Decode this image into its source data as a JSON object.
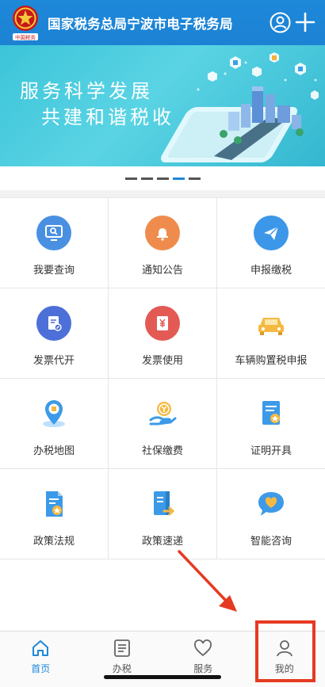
{
  "header": {
    "title": "国家税务总局宁波市电子税务局",
    "emblem_caption": "中国税务"
  },
  "banner": {
    "line1": "服务科学发展",
    "line2": "共建和谐税收",
    "page_count": 5,
    "active_page": 4
  },
  "grid": {
    "items": [
      {
        "label": "我要查询",
        "icon": "monitor-search-icon",
        "color": "#4a90e2"
      },
      {
        "label": "通知公告",
        "icon": "bell-icon",
        "color": "#ef8c4d"
      },
      {
        "label": "申报缴税",
        "icon": "paper-plane-icon",
        "color": "#3d97e8"
      },
      {
        "label": "发票代开",
        "icon": "invoice-edit-icon",
        "color": "#4d6fd8"
      },
      {
        "label": "发票使用",
        "icon": "yen-ticket-icon",
        "color": "#e35a55"
      },
      {
        "label": "车辆购置税申报",
        "icon": "car-icon",
        "color": "#f5b940"
      },
      {
        "label": "办税地图",
        "icon": "map-pin-icon",
        "color": "#3c9ae8"
      },
      {
        "label": "社保缴费",
        "icon": "hand-coin-icon",
        "color": "#f5b940"
      },
      {
        "label": "证明开具",
        "icon": "certificate-icon",
        "color": "#3c9ae8"
      },
      {
        "label": "政策法规",
        "icon": "policy-doc-icon",
        "color": "#3c9ae8"
      },
      {
        "label": "政策速递",
        "icon": "policy-express-icon",
        "color": "#3c9ae8"
      },
      {
        "label": "智能咨询",
        "icon": "chat-heart-icon",
        "color": "#3c9ae8"
      }
    ]
  },
  "tabs": {
    "items": [
      {
        "label": "首页",
        "icon": "home-icon"
      },
      {
        "label": "办税",
        "icon": "list-icon"
      },
      {
        "label": "服务",
        "icon": "heart-icon"
      },
      {
        "label": "我的",
        "icon": "person-icon"
      }
    ],
    "active": 0
  },
  "colors": {
    "brand": "#1e88d9",
    "banner": "#3cc4d9",
    "annotation": "#e53a22"
  }
}
